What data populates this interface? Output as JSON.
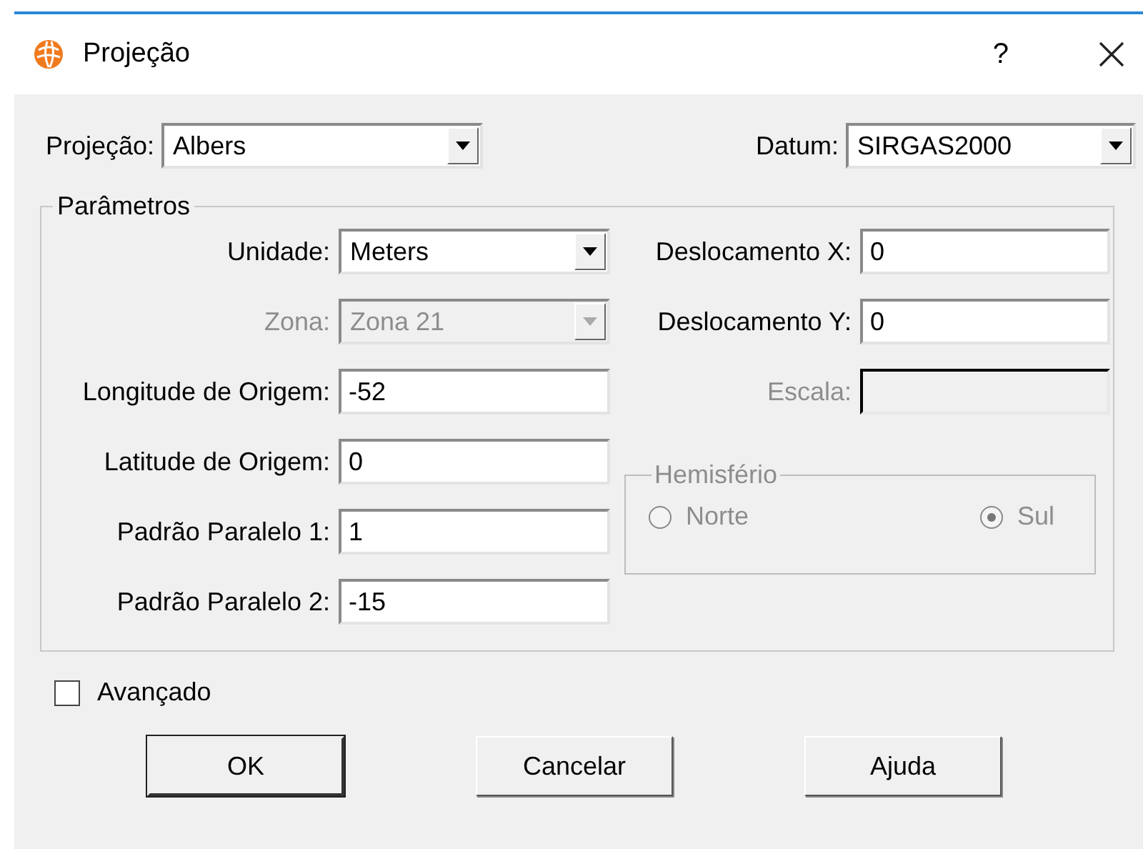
{
  "window": {
    "title": "Projeção",
    "help": "?"
  },
  "projection": {
    "label": "Projeção:",
    "value": "Albers"
  },
  "datum": {
    "label": "Datum:",
    "value": "SIRGAS2000"
  },
  "parameters": {
    "title": "Parâmetros",
    "left_fields": [
      {
        "kind": "combo",
        "label": "Unidade:",
        "value": "Meters",
        "disabled": false
      },
      {
        "kind": "combo",
        "label": "Zona:",
        "value": "Zona 21",
        "disabled": true
      },
      {
        "kind": "text",
        "label": "Longitude de Origem:",
        "value": "-52",
        "disabled": false
      },
      {
        "kind": "text",
        "label": "Latitude de Origem:",
        "value": "0",
        "disabled": false
      },
      {
        "kind": "text",
        "label": "Padrão Paralelo 1:",
        "value": "1",
        "disabled": false
      },
      {
        "kind": "text",
        "label": "Padrão Paralelo 2:",
        "value": "-15",
        "disabled": false
      }
    ],
    "right_fields": [
      {
        "kind": "text",
        "label": "Deslocamento X:",
        "value": "0",
        "disabled": false
      },
      {
        "kind": "text",
        "label": "Deslocamento Y:",
        "value": "0",
        "disabled": false
      },
      {
        "kind": "text",
        "label": "Escala:",
        "disabled": true
      }
    ],
    "hemisphere": {
      "title": "Hemisfério",
      "disabled": true,
      "options": [
        {
          "label": "Norte",
          "selected": false
        },
        {
          "label": "Sul",
          "selected": true
        }
      ]
    }
  },
  "advanced": {
    "label": "Avançado",
    "checked": false
  },
  "buttons": [
    {
      "label": "OK",
      "default": true
    },
    {
      "label": "Cancelar",
      "default": false
    },
    {
      "label": "Ajuda",
      "default": false
    }
  ]
}
